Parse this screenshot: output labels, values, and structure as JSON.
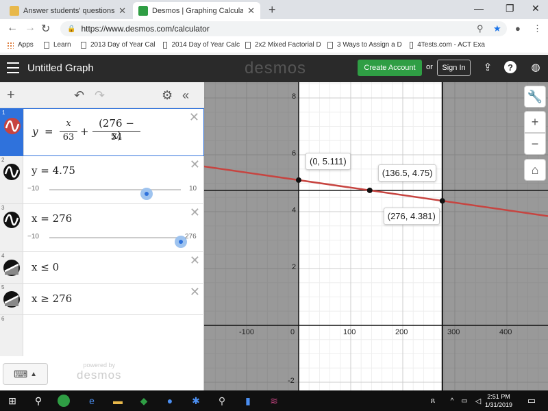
{
  "browser": {
    "tabs": [
      {
        "label": "Answer students' questions and",
        "favicon_color": "#e8b84a",
        "active": false
      },
      {
        "label": "Desmos | Graphing Calculator",
        "favicon_color": "#2f9e44",
        "active": true
      }
    ],
    "url": "https://www.desmos.com/calculator",
    "bookmarks": [
      "Apps",
      "Learn",
      "2013 Day of Year Cal",
      "2014 Day of Year Calc",
      "2x2 Mixed Factorial D",
      "3 Ways to Assign a D",
      "4Tests.com - ACT Exa"
    ]
  },
  "header": {
    "title": "Untitled Graph",
    "brand": "desmos",
    "create_account": "Create Account",
    "or": "or",
    "sign_in": "Sign In",
    "bg_color": "#2a2a2a",
    "accent_green": "#2f9e44"
  },
  "expressions": [
    {
      "num": "1",
      "icon_color": "#c74440",
      "selected": true
    },
    {
      "num": "2",
      "text": "y = 4.75",
      "slider_min": "−10",
      "slider_max": "10",
      "slider_value": 4.75
    },
    {
      "num": "3",
      "text": "x = 276",
      "slider_min": "−10",
      "slider_max": "276",
      "slider_value": 276
    },
    {
      "num": "4",
      "text": "x ≤ 0"
    },
    {
      "num": "5",
      "text": "x ≥ 276"
    },
    {
      "num": "6"
    }
  ],
  "expr1": {
    "y": "y",
    "eq": "=",
    "n1": "x",
    "d1": "63",
    "plus": "+",
    "n2": "(276 − x)",
    "d2": "54"
  },
  "powered": {
    "line1": "powered by",
    "line2": "desmos"
  },
  "graph": {
    "x_ticks": [
      "-100",
      "0",
      "100",
      "200",
      "300",
      "400"
    ],
    "y_ticks": [
      "8",
      "6",
      "4",
      "2",
      "-2"
    ],
    "points": [
      {
        "label": "(0, 5.111)",
        "x": 0,
        "y": 5.111
      },
      {
        "label": "(136.5, 4.75)",
        "x": 136.5,
        "y": 4.75
      },
      {
        "label": "(276, 4.381)",
        "x": 276,
        "y": 4.381
      }
    ],
    "line_color": "#c74440",
    "shade_color": "#555555"
  },
  "taskbar": {
    "time": "2:51 PM",
    "date": "1/31/2019"
  }
}
